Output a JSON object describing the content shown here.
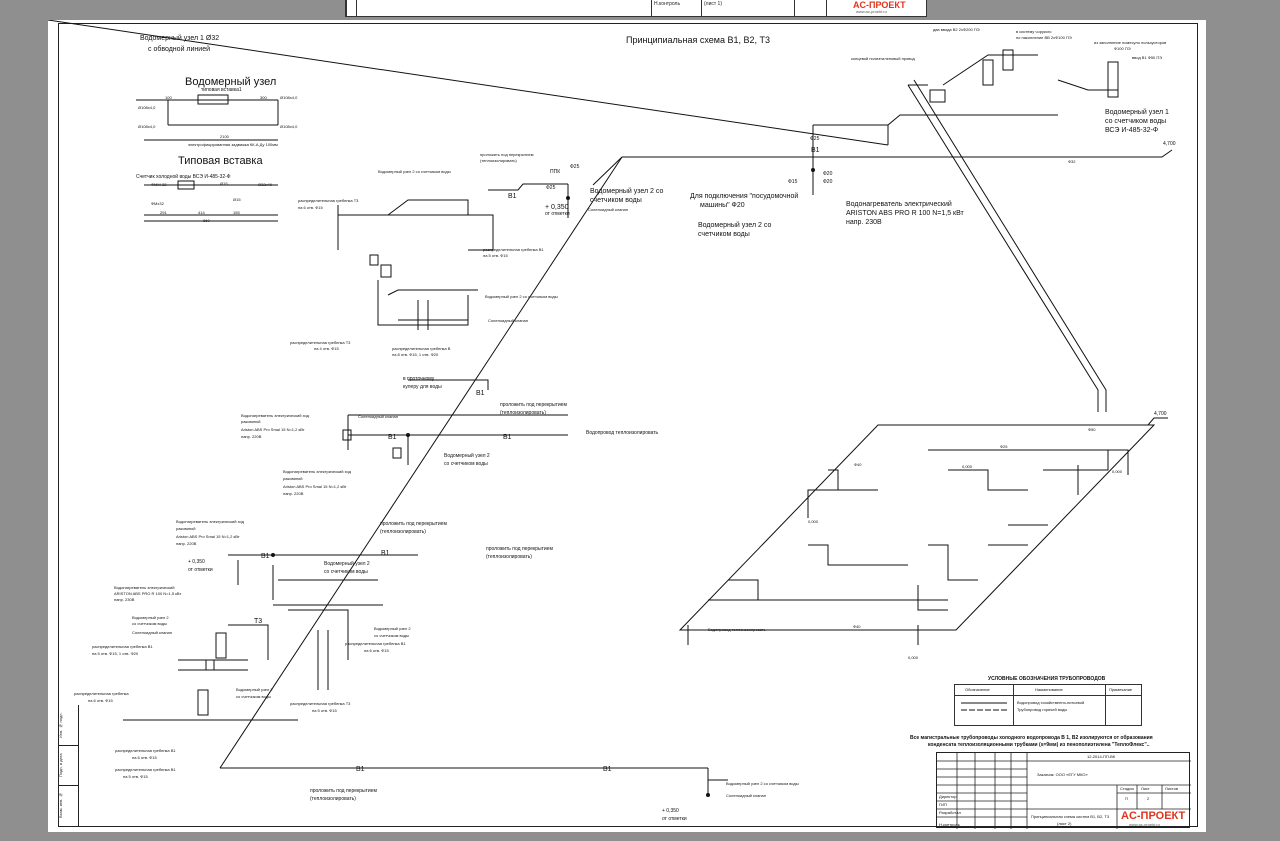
{
  "prev_sheet": {
    "stamp_label": "Н.контроль",
    "sheet_label": "(лист 1)",
    "logo": "AC-ПРОЕКТ",
    "logo_site": "www.ac-proekt.ru"
  },
  "main_title": "Принципиальная схема В1, В2, Т3",
  "meter_title_1": "Водомерный узел 1 Ø32",
  "meter_title_2": "с обводной линией",
  "meter_heading": "Водомерный узел",
  "typical_insert_heading": "Типовая вставка",
  "meter_labels": {
    "insert": "типовая вставка1",
    "d108": "Ø108х4,0",
    "d108b": "Ø108х4,0",
    "d108c": "Ø108х4,0",
    "d108d": "Ø108х4,0",
    "d300": "300",
    "d100": "100",
    "d2100": "2100",
    "valve_note": "электрофицированная задвижка КК-А Ду 100мм"
  },
  "insert_labels": {
    "counter": "Счетчик холодной воды ВСЭ И-485-32-Ф",
    "m32a": "ФММ-32",
    "m32b": "ФМх32",
    "d15": "Ø15",
    "d15b": "Ø15",
    "d32x40": "Ø32х40",
    "d291": "291",
    "d414": "414",
    "d155": "155",
    "d860": "860"
  },
  "notes": {
    "pass_floor_1": "проложить под перекрытием",
    "pass_floor_1b": "(теплоизолировать)",
    "meter_node_2a": "Водомерный узел 2 со счетчиком воды",
    "dist_t3_top": "распределительная гребенка Т3",
    "dist_t3_top_b": "на 6 отв. Ф15",
    "dist_b1_top": "распределительная гребенка В1",
    "dist_b1_top_b": "на 5 отв. Ф15",
    "ppk_1": "ППК",
    "f25_1": "Ф25",
    "f25_2": "Ф25",
    "b1_label_1": "В1",
    "meter_node_big": "Водомерный узел 2 со",
    "meter_node_big_b": "счетчиком воды",
    "plus350": "+ 0,350",
    "plus350b": "от отметки",
    "safety_valve": "Соленоидный клапан",
    "meter_node_4": "Водомерный узел 2 со счетчиком воды",
    "dist_t3_mid": "распределительная гребенка Т3",
    "dist_t3_mid_b": "на 4 отв. Ф15",
    "dist_b_mid": "распределительная гребенка В",
    "dist_b_mid_b": "на 8 отв. Ф15, 1 отв. Ф20",
    "safety_valve_2": "Соленоидный клапан",
    "dishwasher": "Для подключения \"посудомочной",
    "dishwasher_b": "машины\"  Ф20",
    "meter_node_right": "Водомерный узел 2 со",
    "meter_node_right_b": "счетчиком воды",
    "heater_right": "Водонагреватель электрический",
    "heater_right_b": "ARISTON ABS PRO R 100   N=1,5 кВт",
    "heater_right_c": "напр. 230В",
    "meter_node_1": "Водомерный узел 1",
    "meter_node_1b": "со счетчиком воды",
    "meter_node_1c": "ВСЭ И-485-32-Ф",
    "f20_a": "Ф20",
    "f20_b": "Ф20",
    "f15_a": "Ф15",
    "b1_r": "В1",
    "to_cooler": "в проточному",
    "to_cooler_b": "кулеру для воды",
    "b1_cooler": "В1",
    "pass_floor_2": "проложить под перекрытием",
    "pass_floor_2b": "(теплоизолировать)",
    "water_pipe": "Водопровод теплоизолировать",
    "heater_a": "Водонагреватель электрический ход",
    "heater_a_b": "раковиной",
    "heater_a_c": "Ariston ABS Pro Smal 15   N=1,2 кВт",
    "heater_a_d": "напр. 220В",
    "heater_b": "Водонагреватель электрический ход",
    "heater_b_b": "раковиной",
    "heater_b_c": "Ariston ABS Pro Smal 15   N=1,2 кВт",
    "heater_b_d": "напр. 220В",
    "meter_mid": "Водомерный узел 2",
    "meter_mid_b": "со счетчиком воды",
    "safety_mid": "Соленоидный клапан",
    "b1_mid_a": "В1",
    "b1_mid_b": "В1",
    "heater_c": "Водонагреватель электрический ход",
    "heater_c_b": "раковиной",
    "heater_c_c": "Ariston ABS Pro Smal 15   N=1,2 кВт",
    "heater_c_d": "напр. 220В",
    "pass_floor_3": "проложить под перекрытием",
    "pass_floor_3b": "(теплоизолировать)",
    "pass_floor_4": "проложить под перекрытием",
    "pass_floor_4b": "(теплоизолировать)",
    "b1_low_a": "В1",
    "b1_low_b": "В1",
    "meter_low": "Водомерный узел 2",
    "meter_low_b": "со счетчиком воды",
    "plus350c": "+ 0,350",
    "plus350d": "от отметки",
    "heater_d": "Водонагреватель электрический",
    "heater_d_b": "ARISTON ABS PRO R 100  N=1,5 кВт",
    "heater_d_c": "напр. 230В",
    "meter_low_2": "Водомерный узел 2",
    "meter_low_2b": "со счетчиком воды",
    "safety_low": "Соленоидный клапан",
    "dist_b1_low": "распределительная гребенка В1",
    "dist_b1_low_b": "на 5 отв. Ф15, 1 отв. Ф20",
    "dist_low_1": "распределительная гребенка",
    "dist_low_1b": "на 6 отв. Ф15",
    "t3_low": "Т3",
    "meter_low_3": "Водомерный узел 2",
    "meter_low_3b": "со счетчиком воды",
    "dist_b1_low2": "распределительная гребенка В1",
    "dist_b1_low2b": "на 6 отв. Ф15",
    "meter_low_4": "Водомерный узел 2",
    "meter_low_4b": "со счетчиком воды",
    "dist_t3_low": "распределительная гребенка Т3",
    "dist_t3_low_b": "на 5 отв. Ф15",
    "dist_b1_bot": "распределительная гребенка В1",
    "dist_b1_bot_b": "на 6 отв. Ф15",
    "dist_b1_bot2": "распределительная гребенка В1",
    "dist_b1_bot2b": "на 5 отв. Ф15",
    "pass_floor_5": "проложить под перекрытием",
    "pass_floor_5b": "(теплоизолировать)",
    "b1_bottom_a": "В1",
    "b1_bottom_b": "В1",
    "meter_bottom": "Водомерный узел 2 со счетчиком воды",
    "safety_bottom": "Соленоидный клапан",
    "plus350e": "+ 0,350",
    "plus350f": "от отметки",
    "elev_4700a": "4,700",
    "elev_4700b": "4,700",
    "in_system": "в систему чорукого",
    "riser_note": "два ввода В2 2хФ200 ПЭ",
    "riser_note_b": "по накопление ВВ 2хФ100 ПЭ",
    "riser_note_c": "из заполнение помесуло пользуоторов",
    "riser_note_d": "Ф100 ПЭ",
    "riser_note_e": "ввод В1 Ф50 ПЭ",
    "bypass_note": "концевой полиэтиленовый провод"
  },
  "legend": {
    "title": "УСЛОВНЫЕ ОБОЗНАЧЕНИЯ ТРУБОПРОВОДОВ",
    "col1": "Обозначение",
    "col2": "Наименование",
    "col3": "Примечание",
    "row1": "Водопровод хозяйственно-питьевой",
    "row2": "Трубопровод горячей воды"
  },
  "bottom_note": "Все магистральные трубопроводы холодного водопровода В 1, В2 изолируются от образования",
  "bottom_note_b": "конденсата теплоизоляционными трубками (s=9мм) из пенополиэтилена \"ТеплоФлекс\"..",
  "title_block": {
    "doc_code": "12-2014-ПП-ВК",
    "customer": "Заказчик: ООО «ЕГУ МКО»",
    "sheet_title": "Принципиальная схема систем В1, В2, Т3",
    "sheet_sub": "(лист 2)",
    "stage": "Стадия",
    "sheet": "Лист",
    "sheets": "Листов",
    "stage_val": "П",
    "sheet_val": "2",
    "roles": [
      "Директор",
      "ГИП",
      "Разработал",
      "",
      "Н.контроль"
    ],
    "logo": "AC-ПРОЕКТ",
    "logo_site": "www.ac-proekt.ru"
  },
  "side_strip": [
    "Инв. № подл.",
    "Подп. и дата",
    "Взам. инв. №"
  ],
  "plan_labels": {
    "d40a": "Ф40",
    "d40b": "Ф40",
    "d50": "Ф50",
    "d25": "Ф25",
    "d32": "Ф32",
    "v000a": "0,000",
    "v000b": "0,000",
    "v000c": "0,000",
    "v000d": "0,000",
    "riser_label": "Водопровод теплоизолировать"
  },
  "colors": {
    "background": "#8f8f8f",
    "sheet": "#ffffff",
    "line": "#111111",
    "logo": "#e0341f"
  }
}
